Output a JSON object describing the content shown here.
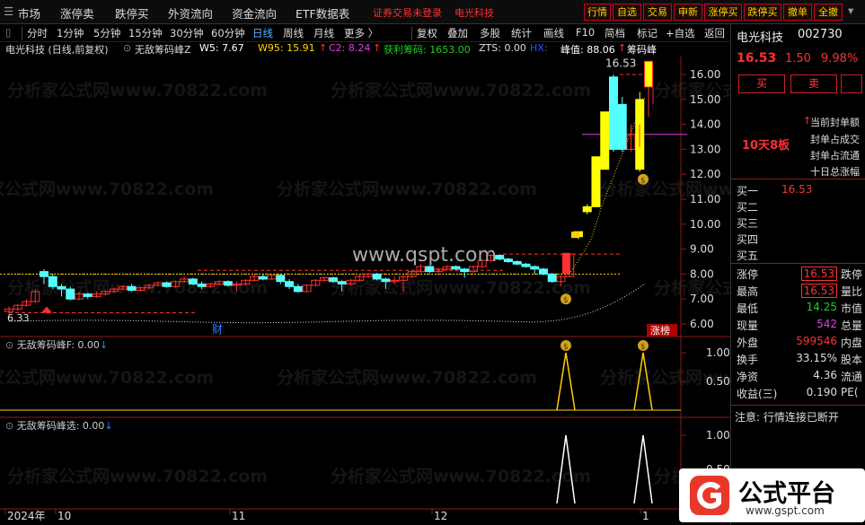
{
  "topbar": {
    "menus": [
      "市场",
      "涨停卖",
      "跌停买",
      "外资流向",
      "资金流向",
      "ETF数据表"
    ],
    "broker_link": "证券交易未登录",
    "stock_link": "电光科技",
    "buttons": [
      "行情",
      "自选",
      "交易",
      "申新",
      "涨停买",
      "跌停买",
      "撤单",
      "全撤"
    ]
  },
  "toolbar": {
    "periods": [
      "分时",
      "1分钟",
      "5分钟",
      "15分钟",
      "30分钟",
      "60分钟",
      "日线",
      "周线",
      "月线",
      "更多 〉"
    ],
    "active_period": "日线",
    "tools": [
      "复权",
      "叠加",
      "多股",
      "统计",
      "画线",
      "F10",
      "简档",
      "标记",
      "+自选",
      "返回"
    ]
  },
  "legend": {
    "title": "电光科技 (日线,前复权)",
    "indicator": "无敌筹码峰Z",
    "w5": "W5: 7.67",
    "w95": "W95: 15.91",
    "w95_arrow": "↑",
    "c2": "C2: 8.24",
    "c2_arrow": "↑",
    "profit": "获利筹码: 1653.00",
    "zts": "ZTS: 0.00",
    "hx": "HX:",
    "peak": "峰值: 88.06",
    "peak_arrow": "↑",
    "tail": "筹码峰"
  },
  "chart_data": {
    "type": "candlestick",
    "y_ticks": [
      "16.00",
      "15.00",
      "14.00",
      "13.00",
      "12.00",
      "11.00",
      "10.00",
      "9.00",
      "8.00",
      "7.00",
      "6.00"
    ],
    "x_ticks": [
      "2024年",
      "10",
      "11",
      "12",
      "1"
    ],
    "high_label": "16.53",
    "low_label": "6.33",
    "event_labels": [
      "财",
      "涨榜"
    ],
    "watermark_url": "www.qspt.com",
    "candles": [
      {
        "o": 6.5,
        "c": 6.6,
        "h": 6.7,
        "l": 6.33
      },
      {
        "o": 6.6,
        "c": 6.75,
        "h": 6.8,
        "l": 6.5
      },
      {
        "o": 6.75,
        "c": 6.9,
        "h": 7.0,
        "l": 6.7
      },
      {
        "o": 6.9,
        "c": 7.3,
        "h": 7.4,
        "l": 6.85
      },
      {
        "o": 8.1,
        "c": 7.9,
        "h": 8.2,
        "l": 7.6
      },
      {
        "o": 7.9,
        "c": 7.5,
        "h": 8.0,
        "l": 7.4
      },
      {
        "o": 7.5,
        "c": 7.4,
        "h": 7.6,
        "l": 7.1
      },
      {
        "o": 7.4,
        "c": 7.0,
        "h": 7.5,
        "l": 6.95
      },
      {
        "o": 7.0,
        "c": 7.2,
        "h": 7.3,
        "l": 6.95
      },
      {
        "o": 7.2,
        "c": 7.1,
        "h": 7.25,
        "l": 7.0
      },
      {
        "o": 7.1,
        "c": 7.2,
        "h": 7.3,
        "l": 7.05
      },
      {
        "o": 7.2,
        "c": 7.3,
        "h": 7.35,
        "l": 7.15
      },
      {
        "o": 7.3,
        "c": 7.4,
        "h": 7.45,
        "l": 7.25
      },
      {
        "o": 7.4,
        "c": 7.5,
        "h": 7.55,
        "l": 7.35
      },
      {
        "o": 7.5,
        "c": 7.35,
        "h": 7.6,
        "l": 7.3
      },
      {
        "o": 7.35,
        "c": 7.45,
        "h": 7.5,
        "l": 7.3
      },
      {
        "o": 7.45,
        "c": 7.55,
        "h": 7.6,
        "l": 7.4
      },
      {
        "o": 7.55,
        "c": 7.65,
        "h": 7.7,
        "l": 7.5
      },
      {
        "o": 7.65,
        "c": 7.5,
        "h": 7.7,
        "l": 7.45
      },
      {
        "o": 7.5,
        "c": 7.7,
        "h": 7.75,
        "l": 7.45
      },
      {
        "o": 7.7,
        "c": 7.8,
        "h": 7.9,
        "l": 7.65
      },
      {
        "o": 7.8,
        "c": 7.6,
        "h": 7.85,
        "l": 7.55
      },
      {
        "o": 7.6,
        "c": 7.5,
        "h": 7.7,
        "l": 7.4
      },
      {
        "o": 7.5,
        "c": 7.6,
        "h": 7.65,
        "l": 7.45
      },
      {
        "o": 7.6,
        "c": 7.7,
        "h": 7.75,
        "l": 7.55
      },
      {
        "o": 7.7,
        "c": 7.55,
        "h": 7.75,
        "l": 7.5
      },
      {
        "o": 7.55,
        "c": 7.6,
        "h": 7.7,
        "l": 7.3
      },
      {
        "o": 7.6,
        "c": 7.75,
        "h": 7.8,
        "l": 7.55
      },
      {
        "o": 7.75,
        "c": 7.9,
        "h": 8.0,
        "l": 7.7
      },
      {
        "o": 7.9,
        "c": 7.8,
        "h": 8.0,
        "l": 7.75
      },
      {
        "o": 7.8,
        "c": 7.95,
        "h": 8.0,
        "l": 7.75
      },
      {
        "o": 7.95,
        "c": 7.7,
        "h": 8.0,
        "l": 7.6
      },
      {
        "o": 7.7,
        "c": 7.5,
        "h": 7.8,
        "l": 7.4
      },
      {
        "o": 7.5,
        "c": 7.3,
        "h": 7.6,
        "l": 7.25
      },
      {
        "o": 7.3,
        "c": 7.55,
        "h": 7.6,
        "l": 7.25
      },
      {
        "o": 7.55,
        "c": 7.75,
        "h": 7.8,
        "l": 7.5
      },
      {
        "o": 7.75,
        "c": 7.85,
        "h": 7.9,
        "l": 7.7
      },
      {
        "o": 7.85,
        "c": 7.7,
        "h": 7.9,
        "l": 7.65
      },
      {
        "o": 7.7,
        "c": 7.6,
        "h": 7.75,
        "l": 7.3
      },
      {
        "o": 7.6,
        "c": 7.75,
        "h": 7.8,
        "l": 7.55
      },
      {
        "o": 7.75,
        "c": 7.9,
        "h": 8.0,
        "l": 7.7
      },
      {
        "o": 7.9,
        "c": 8.0,
        "h": 8.05,
        "l": 7.85
      },
      {
        "o": 8.0,
        "c": 7.8,
        "h": 8.05,
        "l": 7.75
      },
      {
        "o": 7.8,
        "c": 7.7,
        "h": 7.85,
        "l": 7.4
      },
      {
        "o": 7.7,
        "c": 7.75,
        "h": 7.9,
        "l": 7.6
      },
      {
        "o": 7.75,
        "c": 7.9,
        "h": 7.95,
        "l": 7.3
      },
      {
        "o": 7.9,
        "c": 8.1,
        "h": 8.15,
        "l": 7.85
      },
      {
        "o": 8.1,
        "c": 8.3,
        "h": 8.4,
        "l": 8.05
      },
      {
        "o": 8.3,
        "c": 8.1,
        "h": 8.35,
        "l": 8.05
      },
      {
        "o": 8.1,
        "c": 8.2,
        "h": 8.25,
        "l": 8.05
      },
      {
        "o": 8.2,
        "c": 8.3,
        "h": 8.35,
        "l": 8.15
      },
      {
        "o": 8.3,
        "c": 8.2,
        "h": 8.35,
        "l": 8.15
      },
      {
        "o": 8.2,
        "c": 8.1,
        "h": 8.25,
        "l": 7.85
      },
      {
        "o": 8.1,
        "c": 8.3,
        "h": 8.35,
        "l": 8.05
      },
      {
        "o": 8.3,
        "c": 8.55,
        "h": 8.6,
        "l": 8.25
      },
      {
        "o": 8.55,
        "c": 8.75,
        "h": 8.8,
        "l": 8.5
      },
      {
        "o": 8.75,
        "c": 8.6,
        "h": 8.8,
        "l": 8.55
      },
      {
        "o": 8.6,
        "c": 8.5,
        "h": 8.65,
        "l": 8.45
      },
      {
        "o": 8.5,
        "c": 8.4,
        "h": 8.55,
        "l": 8.35
      },
      {
        "o": 8.4,
        "c": 8.3,
        "h": 8.45,
        "l": 8.25
      },
      {
        "o": 8.3,
        "c": 8.2,
        "h": 8.35,
        "l": 8.0
      },
      {
        "o": 8.2,
        "c": 8.0,
        "h": 8.25,
        "l": 7.95
      },
      {
        "o": 8.0,
        "c": 7.7,
        "h": 8.05,
        "l": 7.65
      },
      {
        "o": 7.7,
        "c": 7.9,
        "h": 7.95,
        "l": 7.5
      },
      {
        "o": 7.9,
        "c": 8.8,
        "h": 8.8,
        "l": 7.9
      },
      {
        "o": 9.7,
        "c": 9.5,
        "h": 9.7,
        "l": 9.4
      },
      {
        "o": 10.5,
        "c": 10.7,
        "h": 10.8,
        "l": 10.4
      },
      {
        "o": 10.7,
        "c": 12.7,
        "h": 12.7,
        "l": 10.7
      },
      {
        "o": 12.2,
        "c": 14.5,
        "h": 14.5,
        "l": 12.2
      },
      {
        "o": 15.9,
        "c": 13.0,
        "h": 16.0,
        "l": 12.9
      },
      {
        "o": 14.8,
        "c": 13.0,
        "h": 15.1,
        "l": 12.9
      },
      {
        "o": 13.0,
        "c": 13.6,
        "h": 14.0,
        "l": 12.9
      },
      {
        "o": 15.0,
        "c": 12.2,
        "h": 15.3,
        "l": 12.1
      },
      {
        "o": 15.5,
        "c": 16.53,
        "h": 16.53,
        "l": 14.3
      }
    ],
    "indicator1_title": "无敌筹码峰F",
    "indicator1_value": ": 0.00",
    "indicator1_ticks": [
      "1.00",
      "0.50",
      "0.00"
    ],
    "indicator2_title": "无敌筹码峰选",
    "indicator2_value": ": 0.00",
    "indicator2_ticks": [
      "1.00",
      "0.50"
    ]
  },
  "quote": {
    "name": "电光科技",
    "code": "002730",
    "price": "16.53",
    "change": "1.50",
    "pct": "9.98%",
    "buy": "买",
    "sell": "卖",
    "seal_lines": [
      "当前封单额",
      "封单占成交",
      "封单占流通",
      "十日总涨幅"
    ],
    "streak": "10天8板",
    "bids": [
      {
        "label": "买一",
        "price": "16.53"
      },
      {
        "label": "买二",
        "price": ""
      },
      {
        "label": "买三",
        "price": ""
      },
      {
        "label": "买四",
        "price": ""
      },
      {
        "label": "买五",
        "price": ""
      }
    ],
    "stats": [
      {
        "label": "涨停",
        "value": "16.53",
        "label2": "跌停"
      },
      {
        "label": "最高",
        "value": "16.53",
        "label2": "量比"
      },
      {
        "label": "最低",
        "value": "14.25",
        "label2": "市值"
      },
      {
        "label": "现量",
        "value": "542",
        "label2": "总量"
      },
      {
        "label": "外盘",
        "value": "599546",
        "label2": "内盘"
      },
      {
        "label": "换手",
        "value": "33.15%",
        "label2": "股本"
      },
      {
        "label": "净资",
        "value": "4.36",
        "label2": "流通"
      },
      {
        "label": "收益(三)",
        "value": "0.190",
        "label2": "PE("
      }
    ],
    "notice": "注意: 行情连接已断开"
  },
  "logo": {
    "title": "公式平台",
    "url": "www.gspt.com"
  },
  "watermark_text": "分析家公式网www.70822.com"
}
